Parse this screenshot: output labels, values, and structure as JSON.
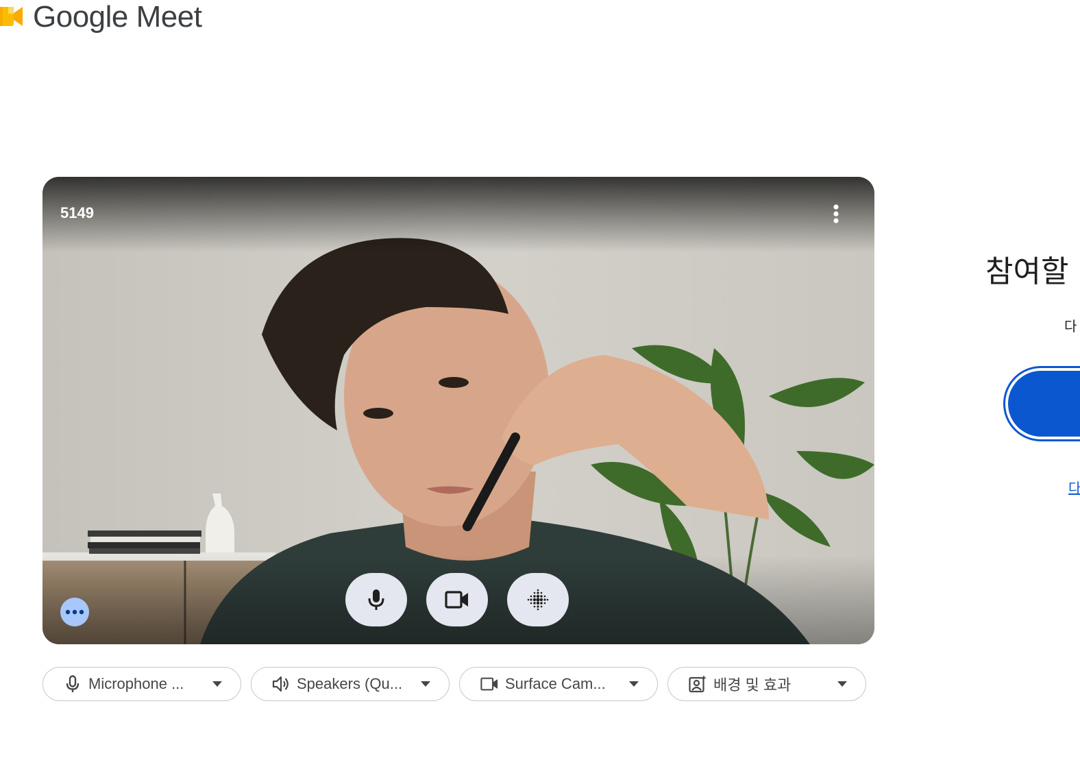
{
  "app": {
    "logo_text": "Google Meet"
  },
  "preview": {
    "participant_name": "5149",
    "controls": [
      {
        "name": "microphone",
        "icon": "microphone-icon"
      },
      {
        "name": "camera",
        "icon": "video-camera-icon"
      },
      {
        "name": "visual-effects",
        "icon": "visual-effects-icon"
      }
    ]
  },
  "devices": {
    "microphone_label": "Microphone ...",
    "speakers_label": "Speakers (Qu...",
    "camera_label": "Surface Cam...",
    "effects_label": "배경 및 효과"
  },
  "join_panel": {
    "title": "참여할",
    "subtitle": "다",
    "link_text": "다"
  },
  "colors": {
    "primary": "#0b57d0",
    "control_bg": "#e4e7ef",
    "effects_bg": "#a8c7fa",
    "text": "#444746"
  }
}
